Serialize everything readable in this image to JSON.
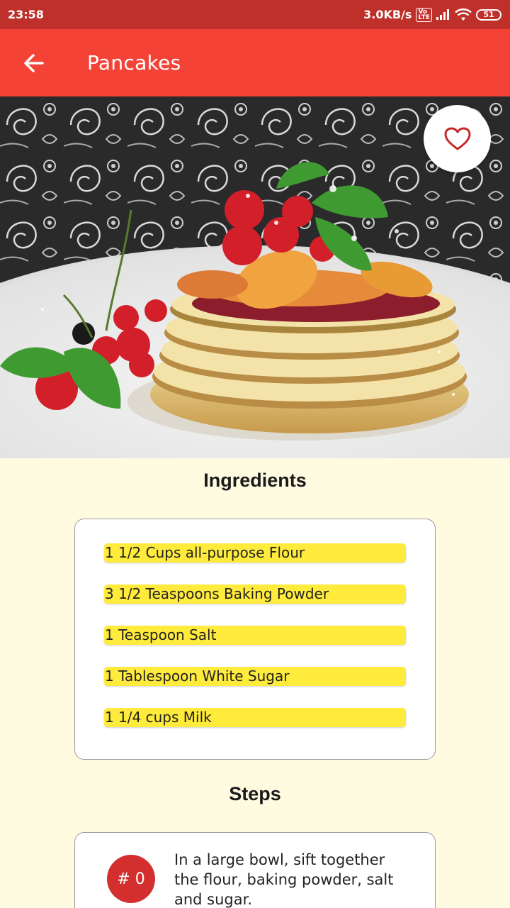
{
  "status_bar": {
    "time": "23:58",
    "network_speed": "3.0KB/s",
    "volte": "VoLTE",
    "battery": "51"
  },
  "app_bar": {
    "back_icon": "arrow-left-icon",
    "title": "Pancakes"
  },
  "hero": {
    "favorite_icon": "heart-outline-icon",
    "accent_color": "#c62828"
  },
  "ingredients": {
    "title": "Ingredients",
    "items": [
      "1 1/2 Cups all-purpose Flour",
      "3 1/2 Teaspoons Baking Powder",
      "1 Teaspoon Salt",
      "1 Tablespoon White Sugar",
      "1 1/4 cups Milk"
    ]
  },
  "steps": {
    "title": "Steps",
    "items": [
      {
        "badge": "# 0",
        "text": "In a large bowl, sift together the flour, baking powder, salt and sugar."
      }
    ]
  },
  "colors": {
    "status_bar": "#c0302a",
    "app_bar": "#f44336",
    "background": "#fffbe0",
    "highlight": "#ffeb3b",
    "badge": "#d32f2f"
  }
}
